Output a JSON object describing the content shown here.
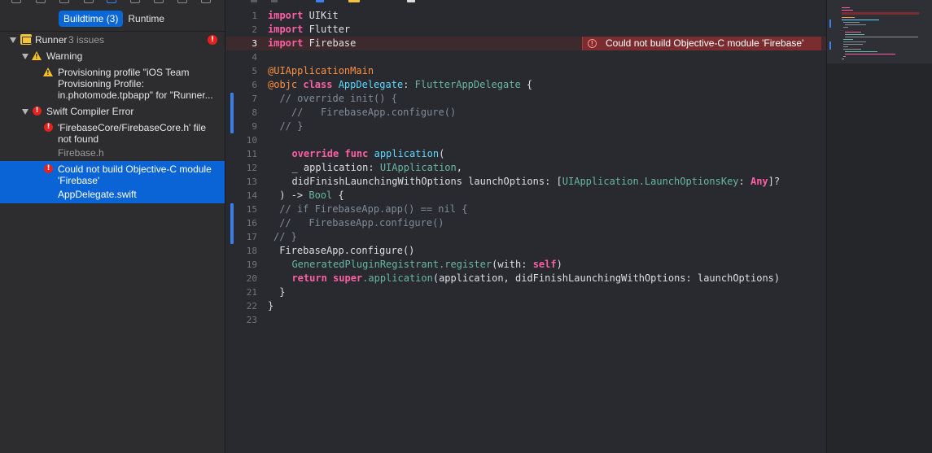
{
  "navigator": {
    "tabs": [
      {
        "label": "Buildtime (3)",
        "selected": true
      },
      {
        "label": "Runtime",
        "selected": false
      }
    ],
    "project": {
      "name": "Runner",
      "issue_count": "3 issues"
    },
    "groups": {
      "warning": {
        "title": "Warning",
        "items": [
          {
            "lines": [
              "Provisioning profile \"iOS Team",
              "Provisioning Profile:",
              "in.photomode.tpbapp\" for \"Runner..."
            ]
          }
        ]
      },
      "swift_error": {
        "title": "Swift Compiler Error",
        "items": [
          {
            "lines": [
              "'FirebaseCore/FirebaseCore.h' file",
              "not found"
            ],
            "file": "Firebase.h"
          },
          {
            "lines": [
              "Could not build Objective-C module",
              "'Firebase'"
            ],
            "file": "AppDelegate.swift",
            "selected": true
          }
        ]
      }
    }
  },
  "editor": {
    "current_line": 3,
    "inline_error": "Could not build Objective-C module 'Firebase'",
    "line_numbers": [
      "1",
      "2",
      "3",
      "4",
      "5",
      "6",
      "7",
      "8",
      "9",
      "10",
      "11",
      "12",
      "13",
      "14",
      "15",
      "16",
      "17",
      "18",
      "19",
      "20",
      "21",
      "22",
      "23"
    ],
    "code": {
      "l1_kw": "import",
      "l1_rest": " UIKit",
      "l2_kw": "import",
      "l2_rest": " Flutter",
      "l3_kw": "import",
      "l3_rest": " Firebase",
      "l5": "@UIApplicationMain",
      "l6_attr": "@objc",
      "l6_kw": " class",
      "l6_type": " AppDelegate",
      "l6_colon": ": ",
      "l6_super": "FlutterAppDelegate",
      "l6_brace": " {",
      "l7": "  // override init() {",
      "l8": "    //   FirebaseApp.configure()",
      "l9": "  // }",
      "l11_kw": "  override func",
      "l11_fn": " application",
      "l11_paren": "(",
      "l12_a": "  _ application: ",
      "l12_type": "UIApplication",
      "l12_b": ",",
      "l13_a": "  didFinishLaunchingWithOptions launchOptions: [",
      "l13_type": "UIApplication.LaunchOptionsKey",
      "l13_b": ": ",
      "l13_any": "Any",
      "l13_c": "]?",
      "l14_a": " ) -> ",
      "l14_type": "Bool",
      "l14_b": " {",
      "l15": " // if FirebaseApp.app() == nil {",
      "l16": " //   FirebaseApp.configure()",
      "l17": "// }",
      "l18": " FirebaseApp.configure()",
      "l19_type": "  GeneratedPluginRegistrant",
      "l19_fn": ".register",
      "l19_a": "(with: ",
      "l19_self": "self",
      "l19_b": ")",
      "l20_kw": "  return",
      "l20_super": " super",
      "l20_fn": ".application",
      "l20_a": "(application, didFinishLaunchingWithOptions: launchOptions)",
      "l21": " }",
      "l22": "}"
    }
  },
  "icons": {
    "error": "error-icon",
    "warning": "warning-icon",
    "app": "app-target-icon",
    "disclosure": "disclosure-triangle-icon"
  },
  "colors": {
    "selection": "#0a64d6",
    "error": "#e8211f",
    "warning": "#f5c02b",
    "keyword": "#fc5fa3",
    "type": "#5dd8ff",
    "comment": "#7f8c98"
  }
}
